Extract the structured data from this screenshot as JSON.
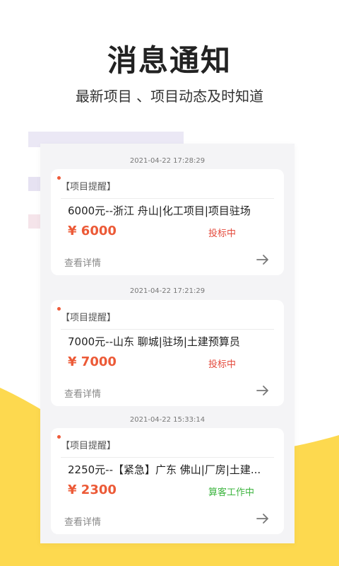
{
  "header": {
    "title": "消息通知",
    "subtitle": "最新项目 、项目动态及时知道"
  },
  "colors": {
    "accent": "#ec5a37",
    "status_red": "#e44a3c",
    "status_green": "#3eb540",
    "wave_yellow": "#fdd94f"
  },
  "notifications": [
    {
      "timestamp": "2021-04-22 17:28:29",
      "tag": "【项目提醒】",
      "title": "6000元--浙江 舟山|化工项目|项目驻场",
      "price": "¥ 6000",
      "status": "投标中",
      "status_color": "#e44a3c",
      "details_label": "查看详情",
      "arrow_icon": "arrow-right-icon"
    },
    {
      "timestamp": "2021-04-22 17:21:29",
      "tag": "【项目提醒】",
      "title": "7000元--山东 聊城|驻场|土建预算员",
      "price": "¥ 7000",
      "status": "投标中",
      "status_color": "#e44a3c",
      "details_label": "查看详情",
      "arrow_icon": "arrow-right-icon"
    },
    {
      "timestamp": "2021-04-22 15:33:14",
      "tag": "【项目提醒】",
      "title": "2250元--【紧急】广东 佛山|厂房|土建...",
      "price": "¥ 2300",
      "status": "算客工作中",
      "status_color": "#3eb540",
      "details_label": "查看详情",
      "arrow_icon": "arrow-right-icon"
    }
  ]
}
